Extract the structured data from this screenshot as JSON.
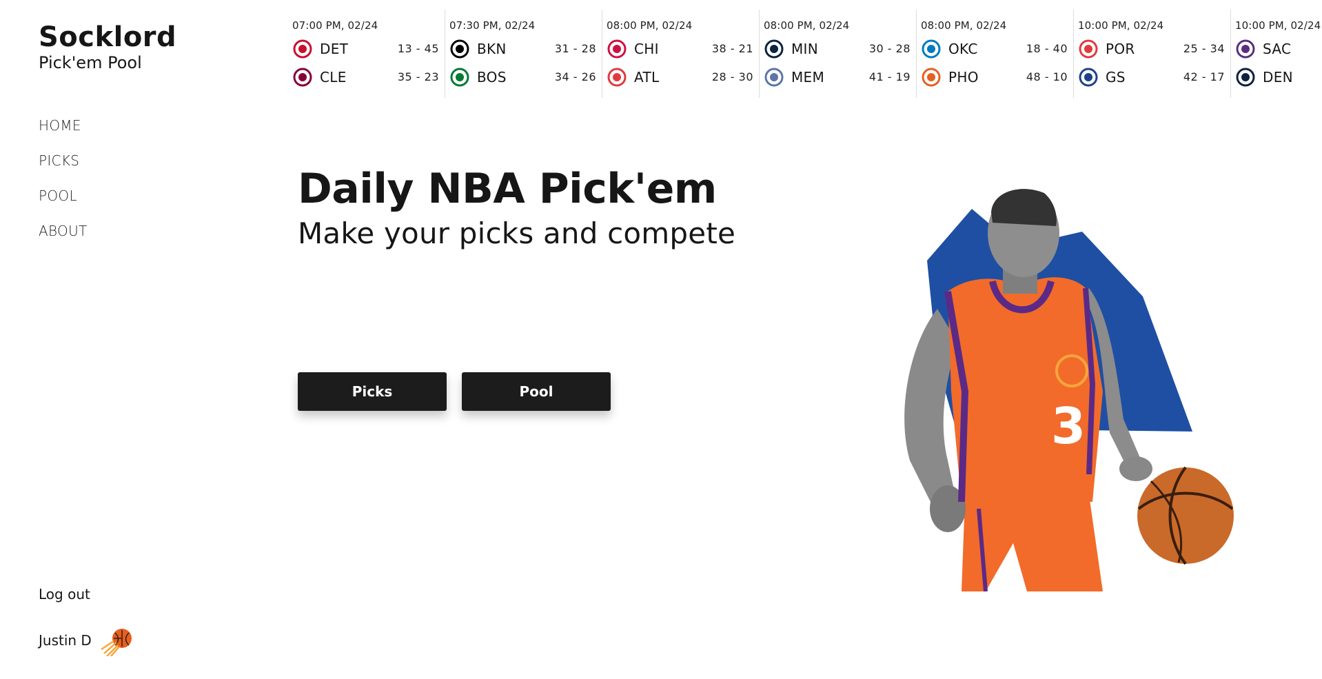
{
  "brand": {
    "title": "Socklord",
    "subtitle": "Pick'em Pool"
  },
  "nav": [
    "HOME",
    "PICKS",
    "POOL",
    "ABOUT"
  ],
  "footer": {
    "logout": "Log out",
    "user_name": "Justin D",
    "user_team_icon": "suns-icon"
  },
  "games": [
    {
      "time": "07:00 PM, 02/24",
      "away": {
        "abbr": "DET",
        "record": "13 - 45",
        "icon": "pistons-icon",
        "color": "#C8102E"
      },
      "home": {
        "abbr": "CLE",
        "record": "35 - 23",
        "icon": "cavaliers-icon",
        "color": "#860038"
      }
    },
    {
      "time": "07:30 PM, 02/24",
      "away": {
        "abbr": "BKN",
        "record": "31 - 28",
        "icon": "nets-icon",
        "color": "#000000"
      },
      "home": {
        "abbr": "BOS",
        "record": "34 - 26",
        "icon": "celtics-icon",
        "color": "#007A33"
      }
    },
    {
      "time": "08:00 PM, 02/24",
      "away": {
        "abbr": "CHI",
        "record": "38 - 21",
        "icon": "bulls-icon",
        "color": "#CE1141"
      },
      "home": {
        "abbr": "ATL",
        "record": "28 - 30",
        "icon": "hawks-icon",
        "color": "#E03A3E"
      }
    },
    {
      "time": "08:00 PM, 02/24",
      "away": {
        "abbr": "MIN",
        "record": "30 - 28",
        "icon": "timberwolves-icon",
        "color": "#0C2340"
      },
      "home": {
        "abbr": "MEM",
        "record": "41 - 19",
        "icon": "grizzlies-icon",
        "color": "#5D76A9"
      }
    },
    {
      "time": "08:00 PM, 02/24",
      "away": {
        "abbr": "OKC",
        "record": "18 - 40",
        "icon": "thunder-icon",
        "color": "#007AC1"
      },
      "home": {
        "abbr": "PHO",
        "record": "48 - 10",
        "icon": "suns-icon",
        "color": "#E56020"
      }
    },
    {
      "time": "10:00 PM, 02/24",
      "away": {
        "abbr": "POR",
        "record": "25 - 34",
        "icon": "trail-blazers-icon",
        "color": "#E03A3E"
      },
      "home": {
        "abbr": "GS",
        "record": "42 - 17",
        "icon": "warriors-icon",
        "color": "#1D428A"
      }
    },
    {
      "time": "10:00 PM, 02/24",
      "away": {
        "abbr": "SAC",
        "record": "",
        "icon": "kings-icon",
        "color": "#5A2D81"
      },
      "home": {
        "abbr": "DEN",
        "record": "",
        "icon": "nuggets-icon",
        "color": "#0E2240"
      }
    }
  ],
  "hero": {
    "title": "Daily NBA Pick'em",
    "subtitle": "Make your picks and compete",
    "picks_button": "Picks",
    "pool_button": "Pool",
    "image_icon": "basketball-player-illustration"
  },
  "colors": {
    "accent": "#1c1c1c",
    "hero_shape": "#1E4FA3",
    "jersey": "#F26B2A"
  }
}
